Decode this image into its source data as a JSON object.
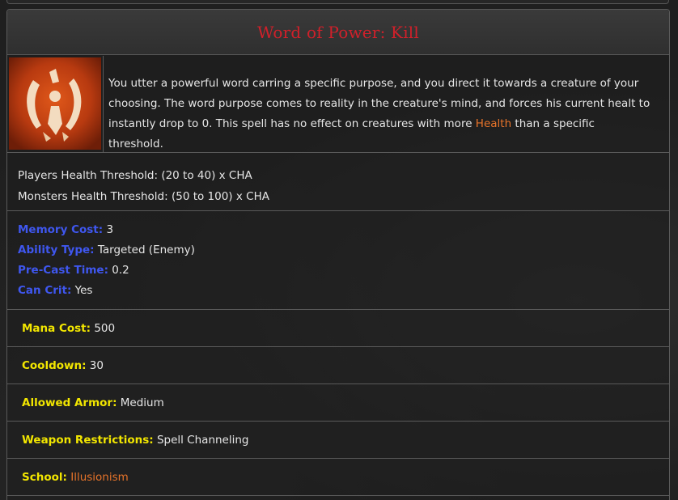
{
  "spell": {
    "title": "Word of Power: Kill",
    "icon": "spell-rune-icon",
    "description": {
      "before": "You utter a powerful word carring a specific purpose, and you direct it towards a creature of your choosing. The word purpose comes to reality in the creature's mind, and forces his current healt to instantly drop to 0. This spell has no effect on creatures with more ",
      "link": "Health",
      "after": " than a specific threshold."
    },
    "thresholds": {
      "players": "Players Health Threshold: (20 to 40) x CHA",
      "monsters": "Monsters Health Threshold: (50 to 100) x CHA"
    },
    "stats": {
      "memory_cost_label": "Memory Cost:",
      "memory_cost_value": " 3",
      "ability_type_label": "Ability Type:",
      "ability_type_value": " Targeted (Enemy)",
      "pre_cast_label": "Pre-Cast Time:",
      "pre_cast_value": " 0.2",
      "can_crit_label": "Can Crit:",
      "can_crit_value": " Yes"
    },
    "details": {
      "mana_cost_label": "Mana Cost:",
      "mana_cost_value": " 500",
      "cooldown_label": "Cooldown:",
      "cooldown_value": " 30",
      "armor_label": "Allowed Armor:",
      "armor_value": " Medium",
      "weapon_label": "Weapon Restrictions:",
      "weapon_value": " Spell Channeling",
      "school_label": "School:",
      "school_value": "Illusionism"
    }
  },
  "colors": {
    "title": "#d0202a",
    "stat_label": "#3f57f0",
    "detail_label": "#f2e600",
    "link": "#e8742a"
  }
}
